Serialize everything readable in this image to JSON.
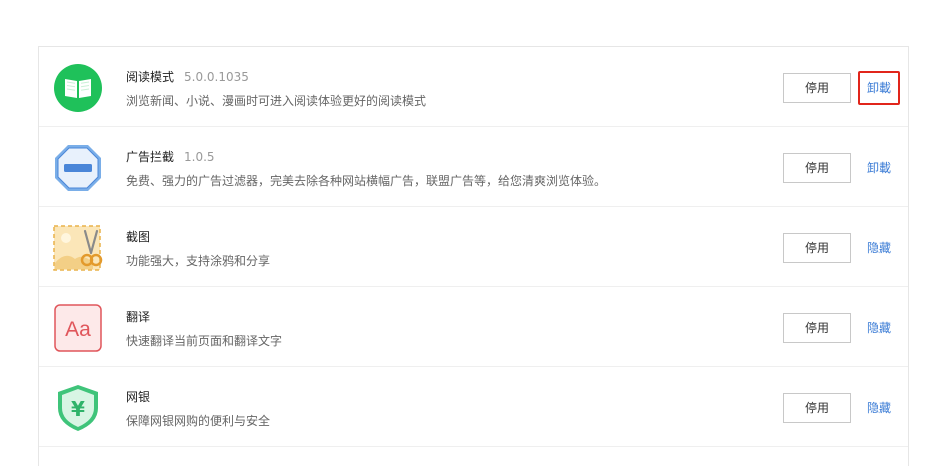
{
  "extensions": [
    {
      "name": "阅读模式",
      "version": "5.0.0.1035",
      "description": "浏览新闻、小说、漫画时可进入阅读体验更好的阅读模式",
      "disable_label": "停用",
      "action_label": "卸載",
      "icon": "book-icon"
    },
    {
      "name": "广告拦截",
      "version": "1.0.5",
      "description": "免费、强力的广告过滤器，完美去除各种网站横幅广告，联盟广告等，给您清爽浏览体验。",
      "disable_label": "停用",
      "action_label": "卸載",
      "icon": "ad-block-icon"
    },
    {
      "name": "截图",
      "version": "",
      "description": "功能强大，支持涂鸦和分享",
      "disable_label": "停用",
      "action_label": "隐藏",
      "icon": "screenshot-scissors-icon"
    },
    {
      "name": "翻译",
      "version": "",
      "description": "快速翻译当前页面和翻译文字",
      "disable_label": "停用",
      "action_label": "隐藏",
      "icon": "translate-icon"
    },
    {
      "name": "网银",
      "version": "",
      "description": "保障网银网购的便利与安全",
      "disable_label": "停用",
      "action_label": "隐藏",
      "icon": "bank-shield-icon"
    }
  ],
  "colors": {
    "link": "#3a7bd5",
    "highlight_border": "#e1251b",
    "reader_green": "#1fc15a",
    "adblock_blue": "#4a86d8",
    "translate_red": "#e0565b",
    "bank_green": "#3fc47a"
  }
}
